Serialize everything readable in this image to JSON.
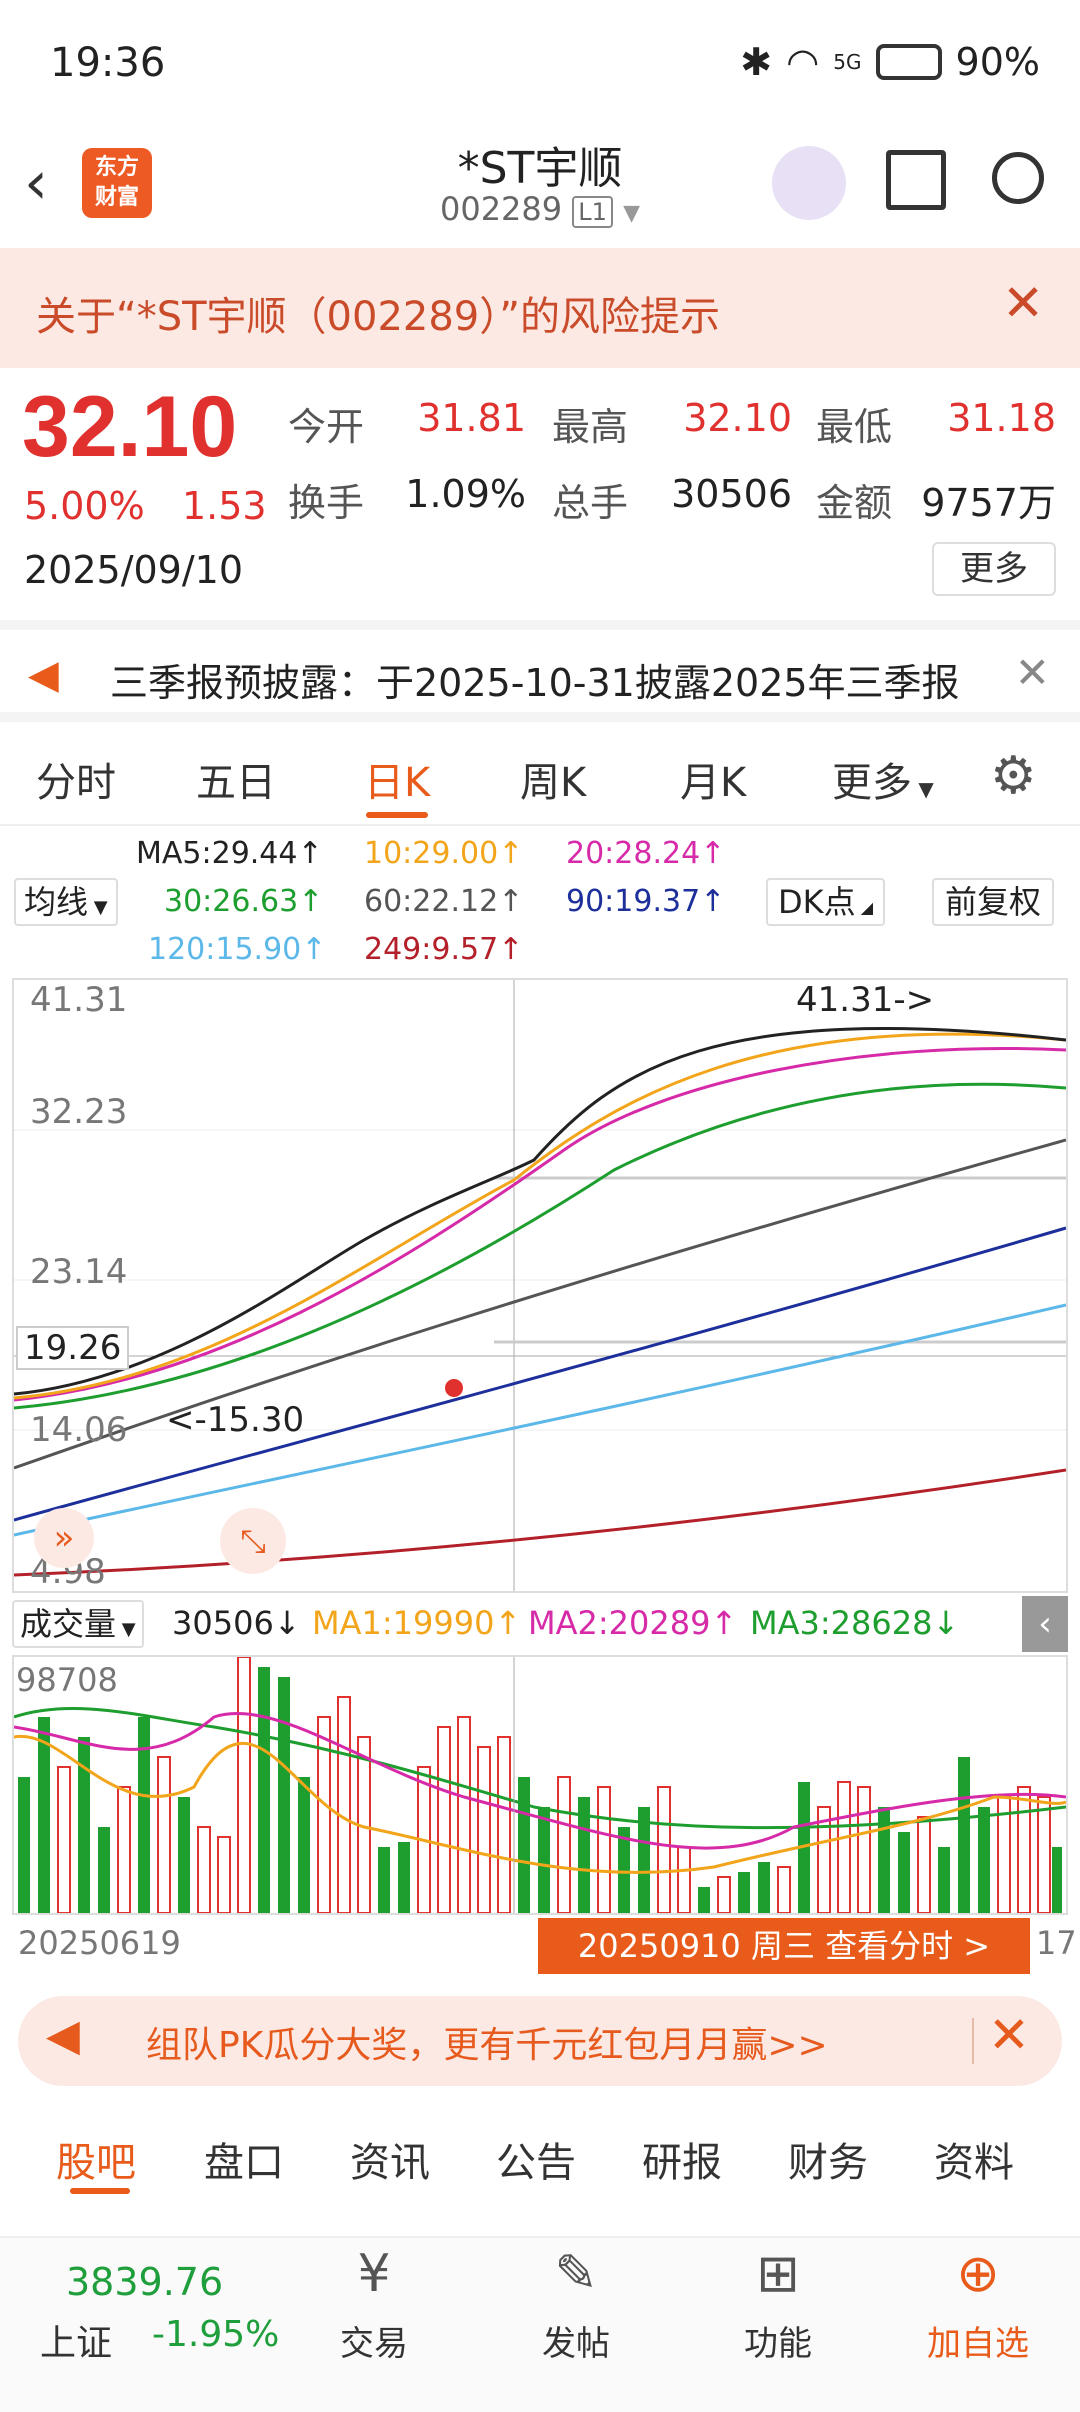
{
  "status_bar": {
    "time": "19:36",
    "battery": "90%",
    "network": "5G"
  },
  "header": {
    "logo_text_line1": "东方",
    "logo_text_line2": "财富",
    "title": "*ST宇顺",
    "code": "002289",
    "level": "L1"
  },
  "risk_notice": {
    "text": "关于“*ST宇顺（002289）”的风险提示"
  },
  "quote": {
    "price": "32.10",
    "change_pct": "5.00%",
    "change": "1.53",
    "date": "2025/09/10",
    "fields": [
      {
        "label": "今开",
        "value": "31.81"
      },
      {
        "label": "最高",
        "value": "32.10"
      },
      {
        "label": "最低",
        "value": "31.18"
      },
      {
        "label": "换手",
        "value": "1.09%"
      },
      {
        "label": "总手",
        "value": "30506"
      },
      {
        "label": "金额",
        "value": "9757万"
      }
    ],
    "more_label": "更多"
  },
  "announcement": {
    "text": "三季报预披露：于2025-10-31披露2025年三季报"
  },
  "period_tabs": [
    "分时",
    "五日",
    "日K",
    "周K",
    "月K",
    "更多"
  ],
  "active_tab": "日K",
  "ma": {
    "selector": "均线",
    "items": [
      {
        "text": "MA5:29.44↑",
        "color": "#222222"
      },
      {
        "text": "10:29.00↑",
        "color": "#f2a51a"
      },
      {
        "text": "20:28.24↑",
        "color": "#d62aa8"
      },
      {
        "text": "30:26.63↑",
        "color": "#1e9e2f"
      },
      {
        "text": "60:22.12↑",
        "color": "#555555"
      },
      {
        "text": "90:19.37↑",
        "color": "#1d2f9b"
      },
      {
        "text": "120:15.90↑",
        "color": "#5cb8e8"
      },
      {
        "text": "249:9.57↑",
        "color": "#b3202a"
      }
    ],
    "dk_label": "DK点",
    "adjust_label": "前复权"
  },
  "kline": {
    "y_labels": [
      "41.31",
      "32.23",
      "23.14",
      "14.06",
      "4.98"
    ],
    "crosshair_price": "19.26",
    "max_marker": "41.31->",
    "min_marker": "<-15.30"
  },
  "volume": {
    "selector": "成交量",
    "value": "30506↓",
    "ma1": "MA1:19990↑",
    "ma2": "MA2:20289↑",
    "ma3": "MA3:28628↓",
    "y_label": "98708",
    "start_date": "20250619",
    "tooltip": "20250910 周三 查看分时 >",
    "end_date_partial": "17"
  },
  "promo": {
    "text": "组队PK瓜分大奖，更有千元红包月月赢>>"
  },
  "bottom_tabs": [
    "股吧",
    "盘口",
    "资讯",
    "公告",
    "研报",
    "财务",
    "资料"
  ],
  "footer": {
    "index_value": "3839.76",
    "index_name": "上证",
    "index_change": "-1.95%",
    "items": [
      "交易",
      "发帖",
      "功能",
      "加自选"
    ]
  }
}
